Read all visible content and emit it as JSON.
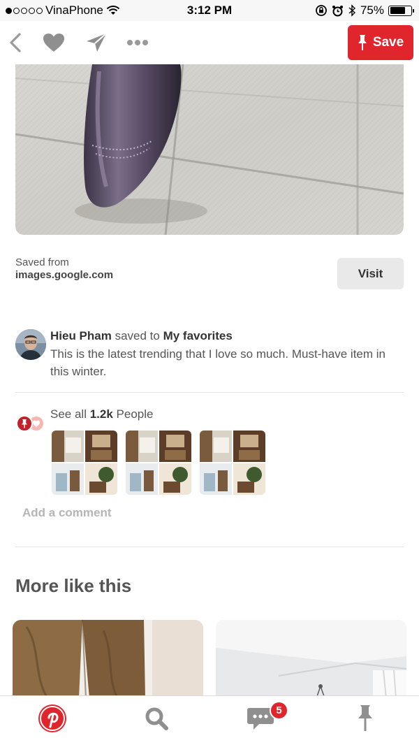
{
  "status_bar": {
    "carrier": "VinaPhone",
    "time": "3:12 PM",
    "battery_percent": "75%",
    "battery_level": 0.75,
    "signal_bars_filled": 1,
    "signal_bars_total": 5
  },
  "nav": {
    "save_label": "Save",
    "icons": [
      "back-icon",
      "heart-icon",
      "send-icon",
      "more-icon",
      "pin-icon"
    ]
  },
  "saved_from": {
    "label": "Saved from",
    "url": "images.google.com",
    "visit_label": "Visit"
  },
  "saver": {
    "name": "Hieu Pham",
    "action": "saved to",
    "board": "My favorites",
    "description": "This is the latest trending that I love so much. Must-have item in this winter."
  },
  "people": {
    "prefix": "See all",
    "count": "1.2k",
    "suffix": "People"
  },
  "comment": {
    "placeholder": "Add a comment"
  },
  "more_like": {
    "title": "More like this"
  },
  "tab_bar": {
    "notification_count": "5",
    "icons": [
      "pinterest-home-icon",
      "search-icon",
      "messages-icon",
      "pin-profile-icon"
    ]
  },
  "colors": {
    "brand_red": "#e0252d",
    "text_gray": "#555555",
    "placeholder_gray": "#b5b5b5",
    "button_gray": "#e9e9e9"
  }
}
